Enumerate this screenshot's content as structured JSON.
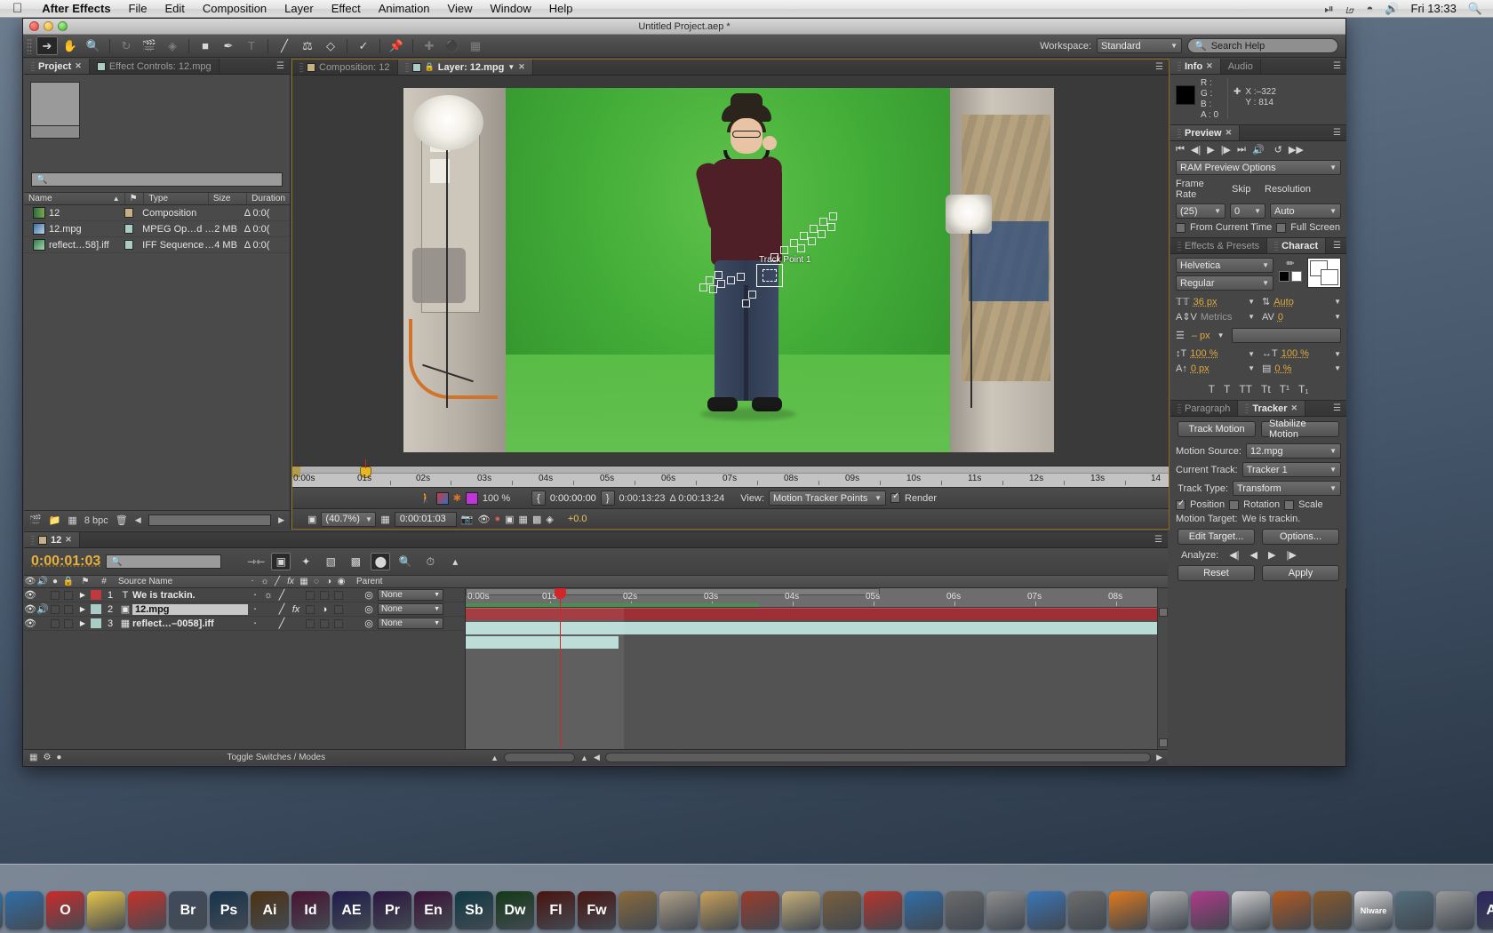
{
  "menubar": {
    "apple": "",
    "items": [
      "After Effects",
      "File",
      "Edit",
      "Composition",
      "Layer",
      "Effect",
      "Animation",
      "View",
      "Window",
      "Help"
    ],
    "status_icons": [
      "timemachine-icon",
      "bluetooth-icon",
      "wifi-icon",
      "volume-icon"
    ],
    "clock": "Fri 13:33",
    "spotlight": "search-icon"
  },
  "window": {
    "title": "Untitled Project.aep *"
  },
  "toolbar": {
    "tools": [
      "selection-tool",
      "hand-tool",
      "zoom-tool",
      "rotation-tool",
      "camera-tool",
      "pan-behind-tool",
      "shape-tool",
      "pen-tool",
      "text-tool",
      "brush-tool",
      "clone-stamp-tool",
      "eraser-tool",
      "roto-brush-tool",
      "puppet-pin-tool",
      "anchor-tool",
      "mask-tool"
    ],
    "workspace_label": "Workspace:",
    "workspace_value": "Standard",
    "search_help": "Search Help"
  },
  "project_panel": {
    "tabs": [
      {
        "label": "Project",
        "active": true,
        "closable": true
      },
      {
        "label": "Effect Controls: 12.mpg",
        "active": false,
        "closable": false
      }
    ],
    "search_placeholder": "",
    "columns": [
      "Name",
      "Type",
      "Size",
      "Duration"
    ],
    "items": [
      {
        "name": "12",
        "type": "Composition",
        "size": "",
        "duration": "Δ 0:0(",
        "color": "#c9b083"
      },
      {
        "name": "12.mpg",
        "type": "MPEG Op…d",
        "size": "…2 MB",
        "duration": "Δ 0:0(",
        "color": "#a9ccc4"
      },
      {
        "name": "reflect…58].iff",
        "type": "IFF Sequence",
        "size": "…4 MB",
        "duration": "Δ 0:0(",
        "color": "#a9ccc4"
      }
    ],
    "footer": {
      "bpc": "8 bpc"
    }
  },
  "viewer": {
    "tabs": [
      {
        "label": "Composition: 12",
        "active": false
      },
      {
        "label": "Layer: 12.mpg",
        "active": true
      }
    ],
    "tracker_label": "Track Point 1",
    "ruler_ticks": [
      "0:00s",
      "01s",
      "02s",
      "03s",
      "04s",
      "05s",
      "06s",
      "07s",
      "08s",
      "09s",
      "10s",
      "11s",
      "12s",
      "13s",
      "14"
    ],
    "bottom_bar": {
      "zoom": "(40.7%)",
      "current_time": "0:00:01:03",
      "opacity": "100 %",
      "in_point": "0:00:00:00",
      "out_point": "0:00:13:23",
      "duration": "Δ 0:00:13:24",
      "view_label": "View:",
      "view_value": "Motion Tracker Points",
      "render_label": "Render",
      "render_checked": true,
      "offset": "+0.0"
    }
  },
  "info_panel": {
    "tabs": [
      {
        "label": "Info",
        "active": true
      },
      {
        "label": "Audio",
        "active": false
      }
    ],
    "channels": [
      "R :",
      "G :",
      "B :",
      "A : 0"
    ],
    "x": "X :–322",
    "y": "Y : 814"
  },
  "preview_panel": {
    "tabs": [
      {
        "label": "Preview",
        "active": true
      }
    ],
    "transport": [
      "first-frame-icon",
      "prev-frame-icon",
      "play-icon",
      "next-frame-icon",
      "last-frame-icon",
      "audio-icon",
      "ram-preview-icon"
    ],
    "ram_preview_options": "RAM Preview Options",
    "frame_rate_label": "Frame Rate",
    "frame_rate_value": "(25)",
    "skip_label": "Skip",
    "skip_value": "0",
    "resolution_label": "Resolution",
    "resolution_value": "Auto",
    "from_current_time": "From Current Time",
    "full_screen": "Full Screen"
  },
  "character_panel": {
    "tabs": [
      {
        "label": "Effects & Presets",
        "active": false
      },
      {
        "label": "Charact",
        "active": true
      }
    ],
    "font_family": "Helvetica",
    "font_style": "Regular",
    "font_size": "36 px",
    "leading": "Auto",
    "kerning": "Metrics",
    "tracking": "0",
    "stroke_width": "– px",
    "vertical_scale": "100 %",
    "horizontal_scale": "100 %",
    "baseline_shift": "0 px",
    "tsume": "0 %",
    "style_buttons": [
      "T",
      "T",
      "TT",
      "Tt",
      "T¹",
      "T₁"
    ]
  },
  "timeline": {
    "tabs": [
      {
        "label": "12",
        "active": true
      }
    ],
    "current_time": "0:00:01:03",
    "search_placeholder": "",
    "columns": [
      "Source Name",
      "Parent"
    ],
    "ruler_ticks": [
      "0:00s",
      "01s",
      "02s",
      "03s",
      "04s",
      "05s",
      "06s",
      "07s",
      "08s"
    ],
    "layers": [
      {
        "index": "1",
        "name": "We is trackin.",
        "color": "#c0393f",
        "parent": "None",
        "type": "text",
        "selected": false
      },
      {
        "index": "2",
        "name": "12.mpg",
        "color": "#a9ccc4",
        "parent": "None",
        "type": "footage",
        "selected": true
      },
      {
        "index": "3",
        "name": "reflect…–0058].iff",
        "color": "#a9ccc4",
        "parent": "None",
        "type": "sequence",
        "selected": false
      }
    ],
    "toggle_switches": "Toggle Switches / Modes"
  },
  "tracker_panel": {
    "tabs": [
      {
        "label": "Paragraph",
        "active": false
      },
      {
        "label": "Tracker",
        "active": true
      }
    ],
    "track_motion": "Track Motion",
    "stabilize_motion": "Stabilize Motion",
    "motion_source_label": "Motion Source:",
    "motion_source_value": "12.mpg",
    "current_track_label": "Current Track:",
    "current_track_value": "Tracker 1",
    "track_type_label": "Track Type:",
    "track_type_value": "Transform",
    "position_label": "Position",
    "position_checked": true,
    "rotation_label": "Rotation",
    "scale_label": "Scale",
    "motion_target_label": "Motion Target:",
    "motion_target_value": "We is trackin.",
    "edit_target": "Edit Target...",
    "options": "Options...",
    "analyze_label": "Analyze:",
    "reset": "Reset",
    "apply": "Apply"
  },
  "dock": {
    "items": [
      {
        "name": "finder",
        "label": "",
        "color": "#3d8fd6"
      },
      {
        "name": "safari",
        "label": "",
        "color": "#2b7bbd"
      },
      {
        "name": "firefox",
        "label": "",
        "color": "#2f6ea8"
      },
      {
        "name": "opera",
        "label": "O",
        "color": "#cc2a2a"
      },
      {
        "name": "duck",
        "label": "",
        "color": "#e8c64a"
      },
      {
        "name": "acrobat",
        "label": "",
        "color": "#c8312a"
      },
      {
        "name": "bridge",
        "label": "Br",
        "color": "#3f4a5c"
      },
      {
        "name": "photoshop",
        "label": "Ps",
        "color": "#16344d"
      },
      {
        "name": "illustrator",
        "label": "Ai",
        "color": "#4d3212"
      },
      {
        "name": "indesign",
        "label": "Id",
        "color": "#4a1231"
      },
      {
        "name": "aftereffects",
        "label": "AE",
        "color": "#1f1b4d"
      },
      {
        "name": "premiere",
        "label": "Pr",
        "color": "#2b1540"
      },
      {
        "name": "encore",
        "label": "En",
        "color": "#3b1238"
      },
      {
        "name": "soundbooth",
        "label": "Sb",
        "color": "#0f3a45"
      },
      {
        "name": "dreamweaver",
        "label": "Dw",
        "color": "#143a18"
      },
      {
        "name": "flash",
        "label": "Fl",
        "color": "#4a1310"
      },
      {
        "name": "fireworks",
        "label": "Fw",
        "color": "#4a1512"
      },
      {
        "name": "app17",
        "label": "",
        "color": "#8a6a3c"
      },
      {
        "name": "app18",
        "label": "",
        "color": "#b0a088"
      },
      {
        "name": "app19",
        "label": "",
        "color": "#c9a15a"
      },
      {
        "name": "app20",
        "label": "",
        "color": "#9a3c2b"
      },
      {
        "name": "app21",
        "label": "",
        "color": "#c7b07a"
      },
      {
        "name": "app22",
        "label": "",
        "color": "#7b5f3d"
      },
      {
        "name": "app23",
        "label": "",
        "color": "#b7342c"
      },
      {
        "name": "app24",
        "label": "",
        "color": "#2f6ea8"
      },
      {
        "name": "app25",
        "label": "",
        "color": "#6b6b6b"
      },
      {
        "name": "app26",
        "label": "",
        "color": "#8e8e8e"
      },
      {
        "name": "app27",
        "label": "",
        "color": "#3a76b8"
      },
      {
        "name": "app28",
        "label": "",
        "color": "#6d6d6d"
      },
      {
        "name": "vlc",
        "label": "",
        "color": "#e07a1c"
      },
      {
        "name": "app30",
        "label": "",
        "color": "#b2b2b2"
      },
      {
        "name": "itunes",
        "label": "",
        "color": "#b03a8a"
      },
      {
        "name": "app32",
        "label": "",
        "color": "#d0d0d0"
      },
      {
        "name": "app33",
        "label": "",
        "color": "#b35a20"
      },
      {
        "name": "garageband",
        "label": "",
        "color": "#8a5a2b"
      },
      {
        "name": "vmware",
        "label": "Nlware",
        "color": "#d6d6d6"
      },
      {
        "name": "app36",
        "label": "",
        "color": "#55707f"
      },
      {
        "name": "app37",
        "label": "",
        "color": "#9a9a9a"
      },
      {
        "name": "aftereffects2",
        "label": "AE",
        "color": "#2a2660"
      },
      {
        "name": "trash",
        "label": "",
        "color": "#c5cdd4"
      }
    ]
  }
}
